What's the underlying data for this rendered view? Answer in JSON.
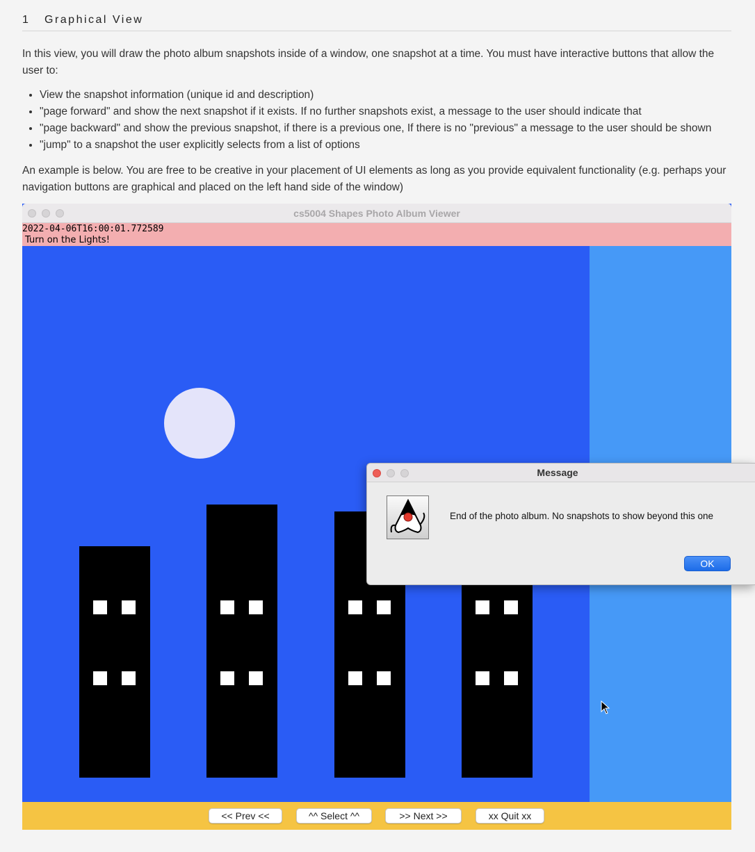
{
  "document": {
    "section_number": "1",
    "section_title": "Graphical View",
    "intro": "In this view, you will draw the photo album snapshots inside of a window, one snapshot at a time. You must have interactive buttons that allow the user to:",
    "requirements": [
      "View the snapshot information (unique id and description)",
      "\"page forward\" and show the next snapshot if it exists. If no further snapshots exist, a message to the user should indicate that",
      "\"page backward\" and show the previous snapshot, if there is a previous one, If there is no \"previous\" a message to the user should be shown",
      "\"jump\" to a snapshot the user explicitly selects from a list of options"
    ],
    "example_note": "An example is below. You are free to be creative in your placement of UI elements as long as you provide equivalent functionality (e.g. perhaps your navigation buttons are graphical and placed on the left hand side of the window)"
  },
  "app_window": {
    "title": "cs5004 Shapes Photo Album Viewer",
    "snapshot_id": "2022-04-06T16:00:01.772589",
    "snapshot_description": "Turn on the Lights!",
    "buttons": {
      "prev": "<< Prev <<",
      "select": "^^ Select ^^",
      "next": ">> Next >>",
      "quit": "xx Quit xx"
    }
  },
  "dialog": {
    "title": "Message",
    "message": "End of the photo album. No snapshots to show beyond this one",
    "ok_label": "OK"
  },
  "colors": {
    "sky": "#2a5cf5",
    "right_panel": "#4699f7",
    "moon": "#e4e4fa",
    "building": "#000000",
    "window_light": "#ffffff",
    "info_bar": "#f3aeb0",
    "button_bar": "#f5c443"
  },
  "icons": {
    "dialog_icon": "java-duke-icon",
    "cursor": "mouse-pointer-icon"
  }
}
